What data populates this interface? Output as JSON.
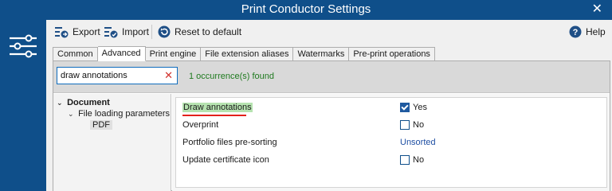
{
  "window": {
    "title": "Print Conductor Settings",
    "close": "✕"
  },
  "toolbar": {
    "export_label": "Export",
    "import_label": "Import",
    "reset_label": "Reset to default",
    "help_label": "Help"
  },
  "tabs": [
    "Common",
    "Advanced",
    "Print engine",
    "File extension aliases",
    "Watermarks",
    "Pre-print operations"
  ],
  "active_tab": "Advanced",
  "search": {
    "value": "draw annotations",
    "clear": "✕",
    "result": "1 occurrence(s) found"
  },
  "tree": {
    "root": "Document",
    "child": "File loading parameters",
    "leaf": "PDF"
  },
  "properties": [
    {
      "label": "Draw annotations",
      "value": "Yes",
      "kind": "checkbox",
      "checked": true
    },
    {
      "label": "Overprint",
      "value": "No",
      "kind": "checkbox",
      "checked": false
    },
    {
      "label": "Portfolio files pre-sorting",
      "value": "Unsorted",
      "kind": "link"
    },
    {
      "label": "Update certificate icon",
      "value": "No",
      "kind": "checkbox",
      "checked": false
    }
  ],
  "colors": {
    "brand": "#0f4f8a",
    "highlight": "#b6e3b0",
    "underline": "#e3211b",
    "found": "#1f7a1f"
  },
  "icons": [
    "settings-sliders-icon",
    "export-icon",
    "import-icon",
    "reset-icon",
    "help-icon",
    "close-icon",
    "chevron-down-icon"
  ]
}
